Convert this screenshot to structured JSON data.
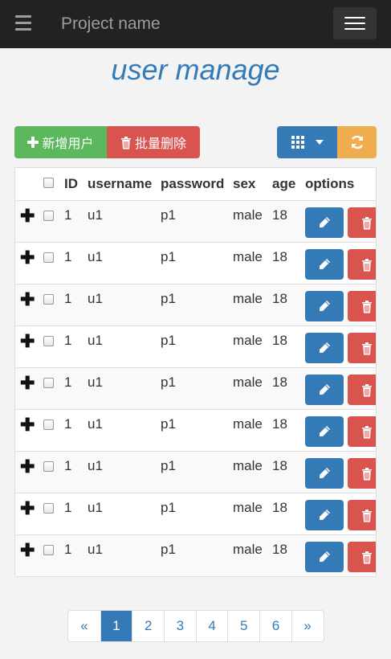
{
  "navbar": {
    "brand": "Project name"
  },
  "page": {
    "title": "user manage"
  },
  "toolbar": {
    "add_label": "新增用户",
    "batch_delete_label": "批量删除"
  },
  "table": {
    "headers": {
      "id": "ID",
      "username": "username",
      "password": "password",
      "sex": "sex",
      "age": "age",
      "options": "options"
    },
    "rows": [
      {
        "expand": "✚",
        "id": "1",
        "username": "u1",
        "password": "p1",
        "sex": "male",
        "age": "18"
      },
      {
        "expand": "✚",
        "id": "1",
        "username": "u1",
        "password": "p1",
        "sex": "male",
        "age": "18"
      },
      {
        "expand": "✚",
        "id": "1",
        "username": "u1",
        "password": "p1",
        "sex": "male",
        "age": "18"
      },
      {
        "expand": "✚",
        "id": "1",
        "username": "u1",
        "password": "p1",
        "sex": "male",
        "age": "18"
      },
      {
        "expand": "✚",
        "id": "1",
        "username": "u1",
        "password": "p1",
        "sex": "male",
        "age": "18"
      },
      {
        "expand": "✚",
        "id": "1",
        "username": "u1",
        "password": "p1",
        "sex": "male",
        "age": "18"
      },
      {
        "expand": "✚",
        "id": "1",
        "username": "u1",
        "password": "p1",
        "sex": "male",
        "age": "18"
      },
      {
        "expand": "✚",
        "id": "1",
        "username": "u1",
        "password": "p1",
        "sex": "male",
        "age": "18"
      },
      {
        "expand": "✚",
        "id": "1",
        "username": "u1",
        "password": "p1",
        "sex": "male",
        "age": "18"
      }
    ]
  },
  "pagination": {
    "prev": "«",
    "pages": [
      "1",
      "2",
      "3",
      "4",
      "5",
      "6"
    ],
    "next": "»",
    "active": "1"
  },
  "colors": {
    "primary": "#337ab7",
    "success": "#5cb85c",
    "danger": "#d9534f",
    "warning": "#f0ad4e",
    "navbar": "#222222"
  }
}
